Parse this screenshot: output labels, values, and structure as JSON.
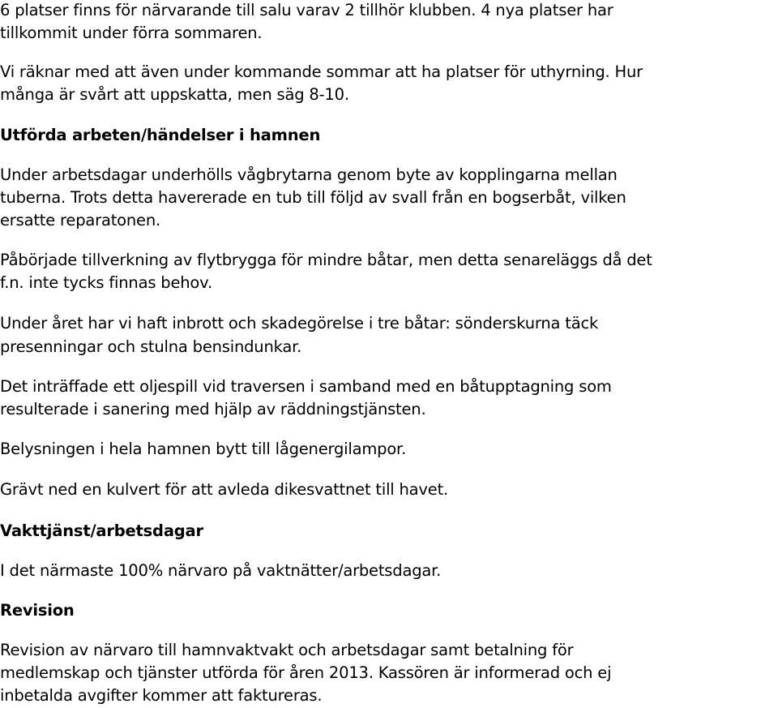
{
  "document": {
    "paragraphs": [
      {
        "type": "text",
        "lines": [
          "6 platser finns för närvarande till salu varav 2 tillhör klubben. 4 nya platser har",
          "tillkommit under förra sommaren."
        ]
      },
      {
        "type": "text",
        "lines": [
          "Vi räknar med att även under kommande sommar att ha platser för uthyrning. Hur",
          "många är svårt att uppskatta, men säg  8-10."
        ]
      },
      {
        "type": "heading",
        "lines": [
          "Utförda arbeten/händelser i hamnen"
        ]
      },
      {
        "type": "text",
        "lines": [
          "Under arbetsdagar underhölls vågbrytarna genom byte av kopplingarna mellan",
          "tuberna. Trots detta havererade en tub till följd av svall från en bogserbåt, vilken",
          "ersatte reparatonen."
        ]
      },
      {
        "type": "text",
        "lines": [
          "Påbörjade tillverkning av flytbrygga för mindre båtar, men detta senareläggs då det",
          "f.n. inte tycks finnas behov."
        ]
      },
      {
        "type": "text",
        "lines": [
          "Under året har vi haft inbrott och skadegörelse i tre båtar: sönderskurna täck",
          "presenningar och stulna bensindunkar."
        ]
      },
      {
        "type": "text",
        "lines": [
          "Det inträffade ett oljespill vid traversen i samband med en båtupptagning som",
          "resulterade i sanering med hjälp av räddningstjänsten."
        ]
      },
      {
        "type": "text",
        "lines": [
          "Belysningen i hela hamnen bytt till lågenergilampor."
        ]
      },
      {
        "type": "text",
        "lines": [
          "Grävt ned en kulvert för att avleda dikesvattnet till havet."
        ]
      },
      {
        "type": "heading",
        "lines": [
          "Vakttjänst/arbetsdagar"
        ]
      },
      {
        "type": "text",
        "lines": [
          "I det närmaste 100% närvaro på vaktnätter/arbetsdagar."
        ]
      },
      {
        "type": "heading",
        "lines": [
          "Revision"
        ]
      },
      {
        "type": "text",
        "lines": [
          "Revision av närvaro till hamnvaktvakt och arbetsdagar samt betalning för",
          "medlemskap och tjänster utförda för åren 2013. Kassören är informerad och ej",
          "inbetalda avgifter kommer att faktureras."
        ]
      }
    ]
  }
}
